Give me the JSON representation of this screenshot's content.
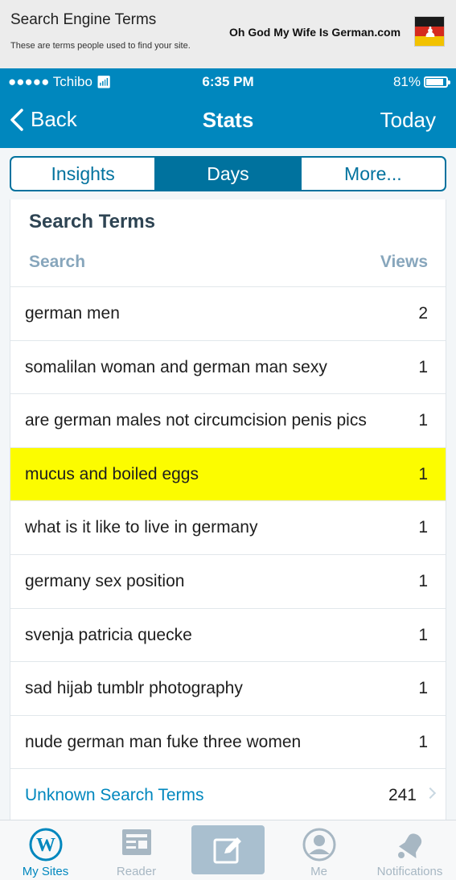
{
  "banner": {
    "title": "Search Engine Terms",
    "subtitle": "These are terms people used to find your site.",
    "site": "Oh God My Wife Is German.com",
    "flag_icon": "german-flag-emblem-icon"
  },
  "status_bar": {
    "carrier": "●●●●● Tchibo",
    "time": "6:35 PM",
    "battery": "81%",
    "battery_level": 0.81
  },
  "nav": {
    "back_label": "Back",
    "title": "Stats",
    "right_label": "Today"
  },
  "segments": [
    {
      "label": "Insights",
      "active": false
    },
    {
      "label": "Days",
      "active": true
    },
    {
      "label": "More...",
      "active": false
    }
  ],
  "card": {
    "title": "Search Terms",
    "col_left": "Search",
    "col_right": "Views",
    "rows": [
      {
        "term": "german men",
        "views": "2"
      },
      {
        "term": "somalilan woman and german man sexy",
        "views": "1"
      },
      {
        "term": "are german males not circumcision penis pics",
        "views": "1"
      },
      {
        "term": "mucus and boiled eggs",
        "views": "1",
        "highlighted": true
      },
      {
        "term": "what is it like to live in germany",
        "views": "1"
      },
      {
        "term": "germany sex position",
        "views": "1"
      },
      {
        "term": "svenja patricia quecke",
        "views": "1"
      },
      {
        "term": "sad hijab tumblr photography",
        "views": "1"
      },
      {
        "term": "nude  german man fuke three women",
        "views": "1"
      }
    ],
    "unknown": {
      "label": "Unknown Search Terms",
      "views": "241"
    }
  },
  "colors": {
    "brand_blue": "#0087be",
    "highlight": "#fcfc00",
    "muted": "#87a6bc"
  },
  "tabbar": {
    "items": [
      {
        "label": "My Sites",
        "icon": "wordpress-icon",
        "active": true
      },
      {
        "label": "Reader",
        "icon": "reader-icon",
        "active": false
      },
      {
        "label": "",
        "icon": "write-post-icon",
        "active": false
      },
      {
        "label": "Me",
        "icon": "user-avatar-icon",
        "active": false
      },
      {
        "label": "Notifications",
        "icon": "bell-icon",
        "active": false
      }
    ]
  }
}
